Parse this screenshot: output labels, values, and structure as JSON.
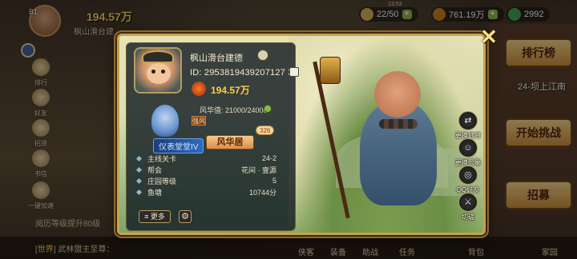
{
  "top": {
    "level": "81",
    "power": "194.57万",
    "name": "枫山滑台建",
    "clock": "13:53",
    "stamina": "22/50",
    "copper": "761.19万",
    "jade": "2992"
  },
  "left_sidebar": [
    "排行",
    "好友",
    "招贤",
    "书信",
    "一键加速"
  ],
  "right_sidebar": {
    "banner_top": "排行榜",
    "stage_label": "24-坝上江南",
    "banner_mid": "开始挑战",
    "banner_bot": "招募"
  },
  "hint": "阅历等级提升80级",
  "chat": {
    "channel": "世界",
    "text": "武林盟主至尊："
  },
  "bottom_nav": [
    "侠客",
    "装备",
    "助战",
    "任务",
    "背包",
    "家园"
  ],
  "profile": {
    "name": "枫山滑台建德",
    "id_label": "ID:",
    "id_value": "2953819439207127 34",
    "power": "194.57万",
    "style_label": "风华值: 21000/24000",
    "style_chip": "强风",
    "hall_label": "仪表堂堂IV",
    "hall_button": "风华居",
    "likes": "326",
    "stats": [
      {
        "label": "主线关卡",
        "value": "24-2"
      },
      {
        "label": "帮会",
        "value": "花间 · 壹源"
      },
      {
        "label": "庄园等级",
        "value": "5"
      },
      {
        "label": "鱼塘",
        "value": "10744分"
      }
    ],
    "more_button": "更多"
  },
  "actions": [
    {
      "label": "更换武将",
      "icon": "swap-hero-icon"
    },
    {
      "label": "更换形象",
      "icon": "swap-look-icon"
    },
    {
      "label": "QQ好友",
      "icon": "qq-icon"
    },
    {
      "label": "切磋",
      "icon": "duel-icon"
    }
  ],
  "colors": {
    "frame": "#c9a14d",
    "power": "#ffcc4d",
    "hall_button": "#d88e4c",
    "hall_label": "#2f6bbf"
  }
}
